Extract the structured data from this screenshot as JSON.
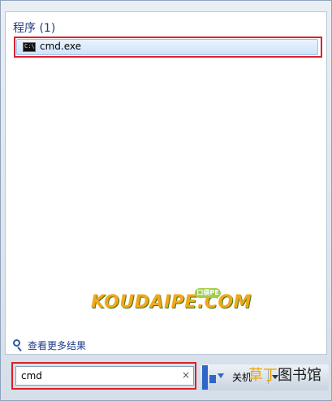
{
  "results": {
    "section_title": "程序 (1)",
    "items": [
      {
        "label": "cmd.exe",
        "icon": "cmd-icon"
      }
    ]
  },
  "watermark": {
    "text": "KOUDAIPE.COM",
    "badge": "口袋PE"
  },
  "more_results": {
    "label": "查看更多结果",
    "icon": "search-icon"
  },
  "search": {
    "value": "cmd",
    "clear_symbol": "×"
  },
  "shutdown": {
    "label": "关机",
    "menu_icon": "chevron-down-icon"
  },
  "overlay_brand": {
    "part1": "草丁",
    "part2": "图书馆"
  }
}
